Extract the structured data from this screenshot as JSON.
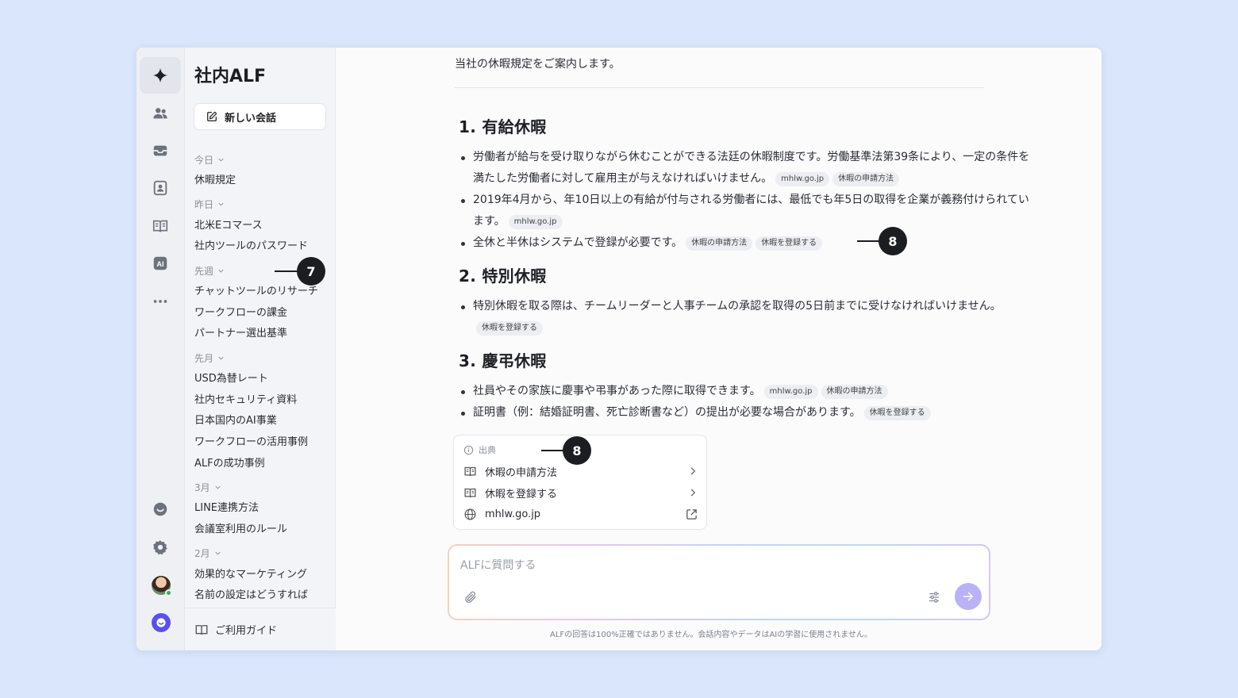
{
  "rail": {
    "items": [
      {
        "name": "ai-sparkle-icon",
        "active": true
      },
      {
        "name": "people-icon"
      },
      {
        "name": "inbox-icon"
      },
      {
        "name": "contact-card-icon"
      },
      {
        "name": "book-icon"
      },
      {
        "name": "ai-badge-icon",
        "text": "AI"
      },
      {
        "name": "more-icon"
      },
      {
        "name": "channel-chat-icon"
      },
      {
        "name": "gear-icon"
      },
      {
        "name": "avatar"
      },
      {
        "name": "channel-logo-icon"
      }
    ]
  },
  "sidebar": {
    "title": "社内ALF",
    "new_chat_label": "新しい会話",
    "groups": [
      {
        "label": "今日",
        "items": [
          "休暇規定"
        ]
      },
      {
        "label": "昨日",
        "items": [
          "北米Eコマース",
          "社内ツールのパスワード"
        ]
      },
      {
        "label": "先週",
        "items": [
          "チャットツールのリサーチ",
          "ワークフローの課金",
          "パートナー選出基準"
        ]
      },
      {
        "label": "先月",
        "items": [
          "USD為替レート",
          "社内セキュリティ資料",
          "日本国内のAI事業",
          "ワークフローの活用事例",
          "ALFの成功事例"
        ]
      },
      {
        "label": "3月",
        "items": [
          "LINE連携方法",
          "会議室利用のルール"
        ]
      },
      {
        "label": "2月",
        "items": [
          "効果的なマーケティング",
          "名前の設定はどうすれば"
        ]
      }
    ],
    "footer_label": "ご利用ガイド"
  },
  "message": {
    "intro": "当社の休暇規定をご案内します。",
    "sections": [
      {
        "heading": "1. 有給休暇",
        "bullets": [
          {
            "text": "労働者が給与を受け取りながら休むことができる法廷の休暇制度です。労働基準法第39条により、一定の条件を満たした労働者に対して雇用主が与えなければいけません。",
            "pills": [
              "mhlw.go.jp",
              "休暇の申請方法"
            ]
          },
          {
            "text": "2019年4月から、年10日以上の有給が付与される労働者には、最低でも年5日の取得を企業が義務付けられています。",
            "pills": [
              "mhlw.go.jp"
            ]
          },
          {
            "text": "全休と半休はシステムで登録が必要です。",
            "pills": [
              "休暇の申請方法",
              "休暇を登録する"
            ]
          }
        ]
      },
      {
        "heading": "2. 特別休暇",
        "bullets": [
          {
            "text": "特別休暇を取る際は、チームリーダーと人事チームの承認を取得の5日前までに受けなければいけません。",
            "pills": [
              "休暇を登録する"
            ]
          }
        ]
      },
      {
        "heading": "3. 慶弔休暇",
        "bullets": [
          {
            "text": "社員やその家族に慶事や弔事があった際に取得できます。",
            "pills": [
              "mhlw.go.jp",
              "休暇の申請方法"
            ]
          },
          {
            "text": "証明書（例：結婚証明書、死亡診断書など）の提出が必要な場合があります。",
            "pills": [
              "休暇を登録する"
            ]
          }
        ]
      }
    ]
  },
  "sources": {
    "label": "出典",
    "items": [
      {
        "label": "休暇の申請方法",
        "icon": "book-icon",
        "action": "chevron-right-icon"
      },
      {
        "label": "休暇を登録する",
        "icon": "book-icon",
        "action": "chevron-right-icon"
      },
      {
        "label": "mhlw.go.jp",
        "icon": "globe-icon",
        "action": "external-link-icon"
      }
    ]
  },
  "markers": {
    "sidebar": "7",
    "pills": "8",
    "sources": "8"
  },
  "composer": {
    "placeholder": "ALFに質問する",
    "disclaimer": "ALFの回答は100%正確ではありません。会話内容やデータはAIの学習に使用されません。"
  },
  "colors": {
    "background": "#d9e6fb",
    "accent": "#5a4ef0",
    "send": "#b9b2f7",
    "marker": "#1b1d20"
  }
}
